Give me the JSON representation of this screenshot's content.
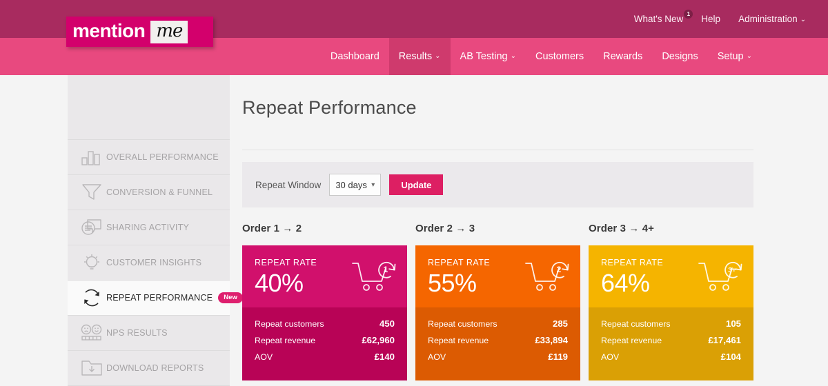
{
  "brand": {
    "logo_word": "mention",
    "logo_me": "me",
    "logo_bg": "#d3006c",
    "topbar_bg": "#a82b5f",
    "nav_bg": "#e8497f",
    "accent": "#dd1f63"
  },
  "topnav": {
    "links": [
      {
        "label": "What's New",
        "badge": "1",
        "caret": false
      },
      {
        "label": "Help",
        "badge": null,
        "caret": false
      },
      {
        "label": "Administration",
        "badge": null,
        "caret": true
      }
    ]
  },
  "mainnav": {
    "items": [
      {
        "label": "Dashboard",
        "caret": false,
        "active": false
      },
      {
        "label": "Results",
        "caret": true,
        "active": true
      },
      {
        "label": "AB Testing",
        "caret": true,
        "active": false
      },
      {
        "label": "Customers",
        "caret": false,
        "active": false
      },
      {
        "label": "Rewards",
        "caret": false,
        "active": false
      },
      {
        "label": "Designs",
        "caret": false,
        "active": false
      },
      {
        "label": "Setup",
        "caret": true,
        "active": false
      }
    ]
  },
  "sidebar": {
    "items": [
      {
        "label": "OVERALL PERFORMANCE",
        "icon": "bar-chart-icon",
        "active": false,
        "badge": null
      },
      {
        "label": "CONVERSION & FUNNEL",
        "icon": "funnel-icon",
        "active": false,
        "badge": null
      },
      {
        "label": "SHARING ACTIVITY",
        "icon": "chat-bubbles-icon",
        "active": false,
        "badge": null
      },
      {
        "label": "CUSTOMER INSIGHTS",
        "icon": "lightbulb-icon",
        "active": false,
        "badge": null
      },
      {
        "label": "REPEAT PERFORMANCE",
        "icon": "refresh-cycle-icon",
        "active": true,
        "badge": "New"
      },
      {
        "label": "NPS RESULTS",
        "icon": "smiley-faces-icon",
        "active": false,
        "badge": null
      },
      {
        "label": "DOWNLOAD REPORTS",
        "icon": "download-folder-icon",
        "active": false,
        "badge": null
      }
    ]
  },
  "main": {
    "title": "Repeat Performance",
    "filter": {
      "label": "Repeat Window",
      "select_value": "30 days",
      "update_label": "Update"
    },
    "cards": [
      {
        "heading": "Order 1 → 2",
        "cart_number": "1",
        "rate_label": "REPEAT RATE",
        "rate_value": "40%",
        "color_top": "#d1106c",
        "color_bottom": "#b80356",
        "stats": [
          {
            "label": "Repeat customers",
            "value": "450"
          },
          {
            "label": "Repeat revenue",
            "value": "£62,960"
          },
          {
            "label": "AOV",
            "value": "£140"
          }
        ]
      },
      {
        "heading": "Order 2 → 3",
        "cart_number": "2",
        "rate_label": "REPEAT RATE",
        "rate_value": "55%",
        "color_top": "#f56600",
        "color_bottom": "#dc5b02",
        "stats": [
          {
            "label": "Repeat customers",
            "value": "285"
          },
          {
            "label": "Repeat revenue",
            "value": "£33,894"
          },
          {
            "label": "AOV",
            "value": "£119"
          }
        ]
      },
      {
        "heading": "Order 3 → 4+",
        "cart_number": "3+",
        "rate_label": "REPEAT RATE",
        "rate_value": "64%",
        "color_top": "#f5b400",
        "color_bottom": "#daa005",
        "stats": [
          {
            "label": "Repeat customers",
            "value": "105"
          },
          {
            "label": "Repeat revenue",
            "value": "£17,461"
          },
          {
            "label": "AOV",
            "value": "£104"
          }
        ]
      }
    ]
  }
}
